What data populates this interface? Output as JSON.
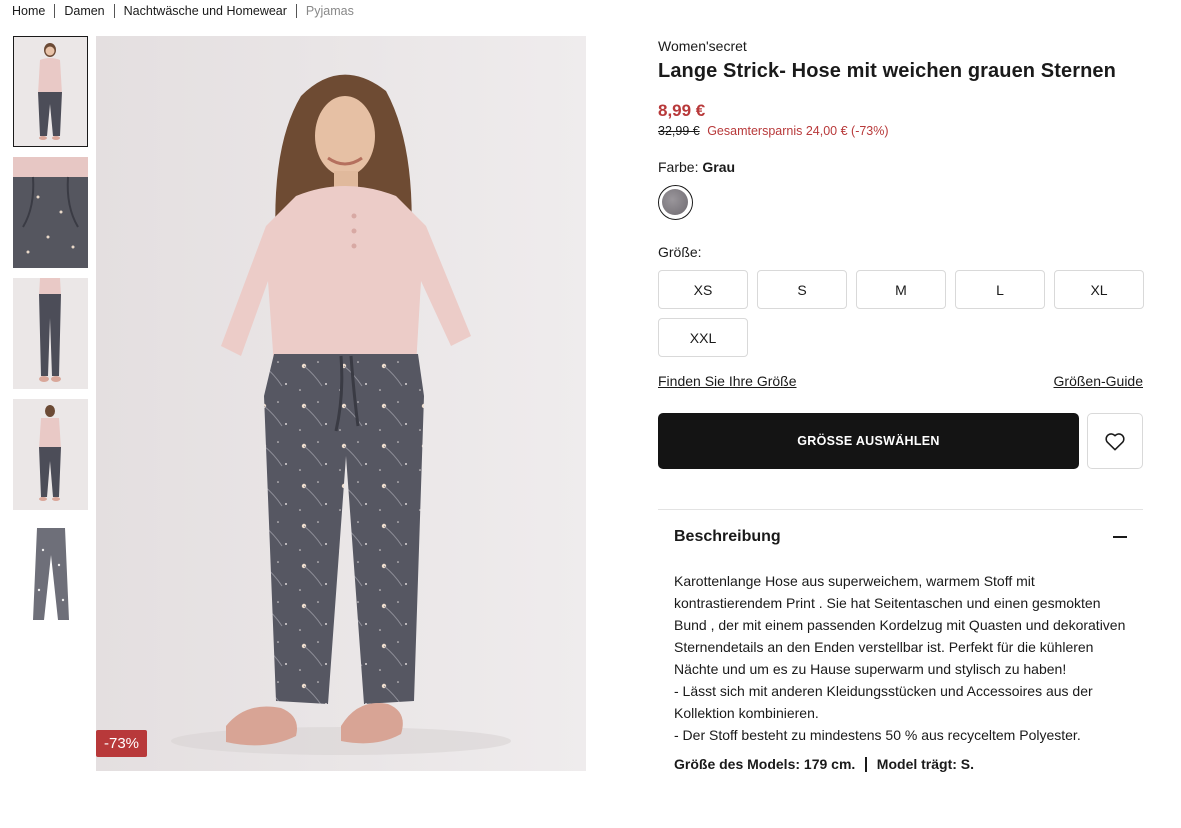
{
  "breadcrumb": {
    "items": [
      "Home",
      "Damen",
      "Nachtwäsche und Homewear"
    ],
    "current": "Pyjamas"
  },
  "gallery": {
    "thumbnails": [
      "model-front",
      "pocket-detail",
      "model-side",
      "model-back",
      "product-flat"
    ],
    "active_index": 0,
    "discount_badge": "-73%"
  },
  "product": {
    "brand": "Women'secret",
    "title": "Lange Strick- Hose mit weichen grauen Sternen",
    "price": "8,99 €",
    "old_price": "32,99 €",
    "savings": "Gesamtersparnis 24,00 € (-73%)",
    "color_label": "Farbe:",
    "color_value": "Grau",
    "color_swatch": "#7e7a80",
    "size_label": "Größe:",
    "sizes": [
      "XS",
      "S",
      "M",
      "L",
      "XL",
      "XXL"
    ],
    "find_size_link": "Finden Sie Ihre Größe",
    "size_guide_link": "Größen-Guide",
    "cta_label": "GRÖSSE AUSWÄHLEN",
    "wishlist_icon": "heart-icon"
  },
  "description": {
    "title": "Beschreibung",
    "text": "Karottenlange Hose aus superweichem, warmem Stoff mit kontrastierendem Print . Sie hat Seitentaschen und einen gesmokten Bund , der mit einem passenden Kordelzug mit Quasten und dekorativen Sternendetails an den Enden verstellbar ist. Perfekt für die kühleren Nächte und um es zu Hause superwarm und stylisch zu haben!",
    "bullet_1": "- Lässt sich mit anderen Kleidungsstücken und Accessoires aus der Kollektion kombinieren.",
    "bullet_2": "- Der Stoff besteht zu mindestens 50 % aus recyceltem Polyester.",
    "model_height": "Größe des Models: 179 cm.",
    "model_size": "Model trägt: S."
  },
  "colors": {
    "accent_red": "#b8393a",
    "cta_black": "#141414"
  }
}
